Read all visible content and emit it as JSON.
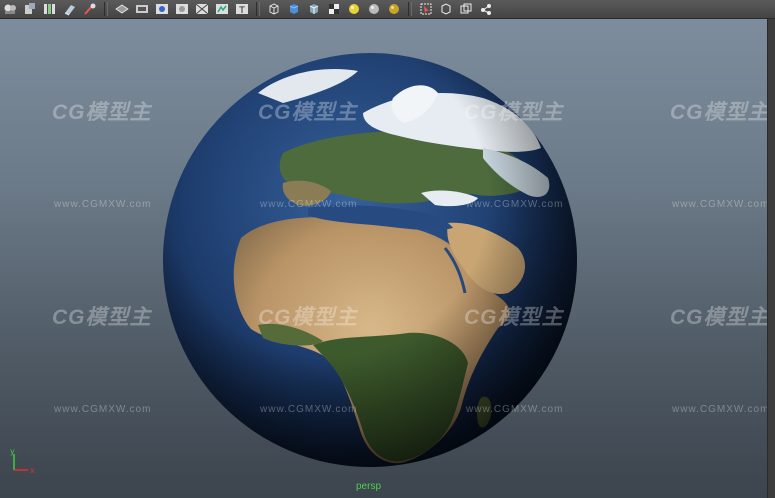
{
  "toolbar": {
    "icons": [
      "camera-attributes-icon",
      "bookmark-icon",
      "image-plane-icon",
      "2d-pan-icon",
      "grease-pencil-icon",
      "grid-icon",
      "film-gate-icon",
      "resolution-gate-icon",
      "gate-mask-icon",
      "field-chart-icon",
      "safe-action-icon",
      "safe-title-icon",
      "wireframe-icon",
      "smooth-shade-icon",
      "wireframe-on-shaded-icon",
      "textured-icon",
      "use-all-lights-icon",
      "shadows-icon",
      "ambient-occlusion-icon",
      "isolate-select-icon",
      "xray-icon",
      "xray-joints-icon",
      "xray-components-icon"
    ]
  },
  "viewport": {
    "camera_label": "persp",
    "axis": {
      "x": "x",
      "y": "y"
    },
    "watermark": {
      "logo": "CG模型主",
      "url": "www.CGMXW.com"
    }
  },
  "colors": {
    "camera_label": "#4bd04b",
    "background_top": "#7d8d9d",
    "background_bottom": "#3c444d"
  }
}
